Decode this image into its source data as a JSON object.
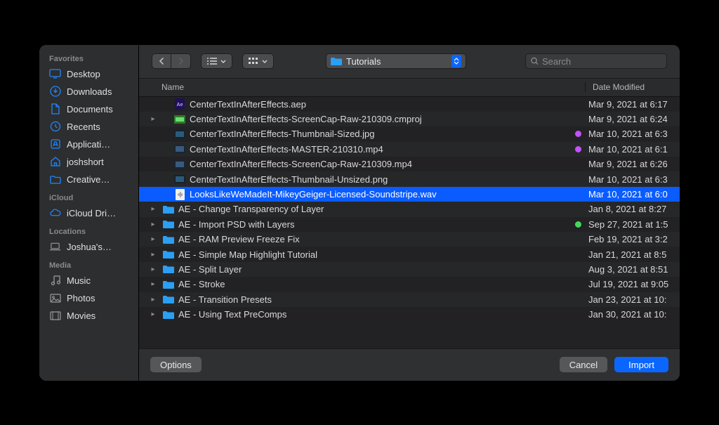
{
  "sidebar": {
    "sections": [
      {
        "title": "Favorites",
        "items": [
          {
            "label": "Desktop",
            "icon": "desktop-icon"
          },
          {
            "label": "Downloads",
            "icon": "downloads-icon"
          },
          {
            "label": "Documents",
            "icon": "documents-icon"
          },
          {
            "label": "Recents",
            "icon": "recents-icon"
          },
          {
            "label": "Applicati…",
            "icon": "applications-icon"
          },
          {
            "label": "joshshort",
            "icon": "home-icon"
          },
          {
            "label": "Creative…",
            "icon": "folder-icon"
          }
        ]
      },
      {
        "title": "iCloud",
        "items": [
          {
            "label": "iCloud Dri…",
            "icon": "cloud-icon"
          }
        ]
      },
      {
        "title": "Locations",
        "items": [
          {
            "label": "Joshua's…",
            "icon": "laptop-icon"
          }
        ]
      },
      {
        "title": "Media",
        "items": [
          {
            "label": "Music",
            "icon": "music-icon"
          },
          {
            "label": "Photos",
            "icon": "photos-icon"
          },
          {
            "label": "Movies",
            "icon": "movies-icon"
          }
        ]
      }
    ]
  },
  "toolbar": {
    "current_folder": "Tutorials",
    "search_placeholder": "Search"
  },
  "columns": {
    "name": "Name",
    "date_modified": "Date Modified"
  },
  "files": [
    {
      "name": "CenterTextInAfterEffects.aep",
      "date": "Mar 9, 2021 at 6:17",
      "icon": "aep",
      "expandable": false,
      "indent": 1,
      "tag": null
    },
    {
      "name": "CenterTextInAfterEffects-ScreenCap-Raw-210309.cmproj",
      "date": "Mar 9, 2021 at 6:24",
      "icon": "cmproj",
      "expandable": true,
      "indent": 1,
      "tag": null
    },
    {
      "name": "CenterTextInAfterEffects-Thumbnail-Sized.jpg",
      "date": "Mar 10, 2021 at 6:3",
      "icon": "jpg",
      "expandable": false,
      "indent": 1,
      "tag": "purple"
    },
    {
      "name": "CenterTextInAfterEffects-MASTER-210310.mp4",
      "date": "Mar 10, 2021 at 6:1",
      "icon": "mp4",
      "expandable": false,
      "indent": 1,
      "tag": "purple"
    },
    {
      "name": "CenterTextInAfterEffects-ScreenCap-Raw-210309.mp4",
      "date": "Mar 9, 2021 at 6:26",
      "icon": "mp4",
      "expandable": false,
      "indent": 1,
      "tag": null
    },
    {
      "name": "CenterTextInAfterEffects-Thumbnail-Unsized.png",
      "date": "Mar 10, 2021 at 6:3",
      "icon": "png",
      "expandable": false,
      "indent": 1,
      "tag": null
    },
    {
      "name": "LooksLikeWeMadeIt-MikeyGeiger-Licensed-Soundstripe.wav",
      "date": "Mar 10, 2021 at 6:0",
      "icon": "wav",
      "expandable": false,
      "indent": 1,
      "tag": null,
      "selected": true
    },
    {
      "name": "AE - Change Transparency of Layer",
      "date": "Jan 8, 2021 at 8:27",
      "icon": "folder",
      "expandable": true,
      "indent": 0,
      "tag": null
    },
    {
      "name": "AE - Import PSD with Layers",
      "date": "Sep 27, 2021 at 1:5",
      "icon": "folder",
      "expandable": true,
      "indent": 0,
      "tag": "green"
    },
    {
      "name": "AE - RAM Preview Freeze Fix",
      "date": "Feb 19, 2021 at 3:2",
      "icon": "folder",
      "expandable": true,
      "indent": 0,
      "tag": null
    },
    {
      "name": "AE - Simple Map Highlight Tutorial",
      "date": "Jan 21, 2021 at 8:5",
      "icon": "folder",
      "expandable": true,
      "indent": 0,
      "tag": null
    },
    {
      "name": "AE - Split Layer",
      "date": "Aug 3, 2021 at 8:51",
      "icon": "folder",
      "expandable": true,
      "indent": 0,
      "tag": null
    },
    {
      "name": "AE - Stroke",
      "date": "Jul 19, 2021 at 9:05",
      "icon": "folder",
      "expandable": true,
      "indent": 0,
      "tag": null
    },
    {
      "name": "AE - Transition Presets",
      "date": "Jan 23, 2021 at 10:",
      "icon": "folder",
      "expandable": true,
      "indent": 0,
      "tag": null
    },
    {
      "name": "AE - Using Text PreComps",
      "date": "Jan 30, 2021 at 10:",
      "icon": "folder",
      "expandable": true,
      "indent": 0,
      "tag": null
    }
  ],
  "footer": {
    "options_label": "Options",
    "cancel_label": "Cancel",
    "import_label": "Import"
  }
}
